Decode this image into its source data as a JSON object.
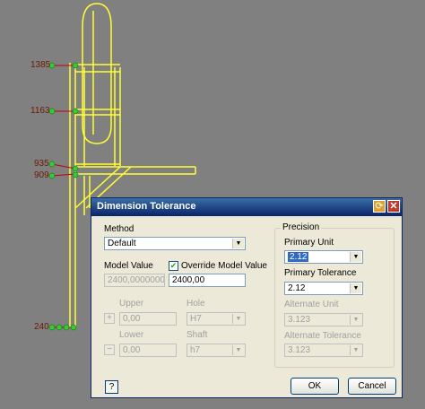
{
  "drawing": {
    "dimensions": [
      "1385",
      "1163",
      "935",
      "909",
      "240"
    ]
  },
  "dialog": {
    "title": "Dimension Tolerance",
    "method_label": "Method",
    "method_value": "Default",
    "model_value_label": "Model Value",
    "model_value": "2400,00000000",
    "override_label": "Override Model Value",
    "override_checked": true,
    "override_value": "2400,00",
    "upper_label": "Upper",
    "upper_value": "0,00",
    "lower_label": "Lower",
    "lower_value": "0,00",
    "hole_label": "Hole",
    "hole_value": "H7",
    "shaft_label": "Shaft",
    "shaft_value": "h7",
    "plus_symbol": "+",
    "minus_symbol": "−",
    "precision": {
      "group_label": "Precision",
      "primary_unit_label": "Primary Unit",
      "primary_unit_value": "2.12",
      "primary_tolerance_label": "Primary Tolerance",
      "primary_tolerance_value": "2.12",
      "alternate_unit_label": "Alternate Unit",
      "alternate_unit_value": "3.123",
      "alternate_tolerance_label": "Alternate Tolerance",
      "alternate_tolerance_value": "3.123"
    },
    "help_label": "?",
    "ok_label": "OK",
    "cancel_label": "Cancel"
  },
  "colors": {
    "canvas_bg": "#808080",
    "geometry": "#ffff33",
    "dim_line": "#c00000",
    "dim_point": "#33cc33",
    "dim_text": "#6b1a00"
  }
}
